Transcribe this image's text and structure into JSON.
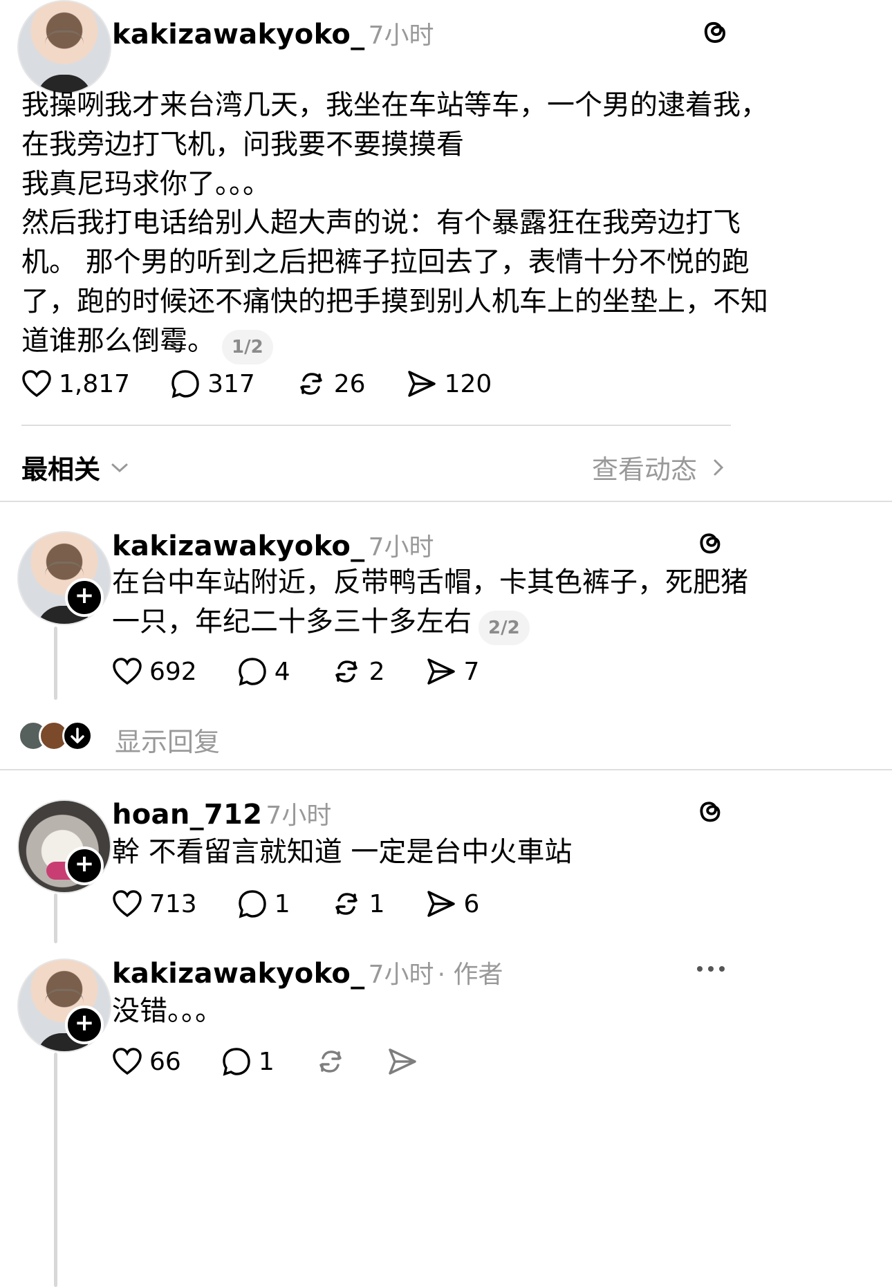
{
  "post": {
    "username": "kakizawakyoko_",
    "time": "7小时",
    "text": "我操咧我才来台湾几天，我坐在车站等车，一个男的逮着我，\n在我旁边打飞机，问我要不要摸摸看",
    "text2": "我真尼玛求你了。。。",
    "text3": "然后我打电话给别人超大声的说：有个暴露狂在我旁边打飞\n机。 那个男的听到之后把裤子拉回去了，表情十分不悦的跑\n了，跑的时候还不痛快的把手摸到别人机车上的坐垫上，不知\n道谁那么倒霉。",
    "pager": "1/2",
    "likes": "1,817",
    "comments": "317",
    "reposts": "26",
    "shares": "120"
  },
  "sort": {
    "label": "最相关",
    "activity": "查看动态"
  },
  "replies": [
    {
      "username": "kakizawakyoko_",
      "time": "7小时",
      "text": "在台中车站附近，反带鸭舌帽，卡其色裤子，死肥猪\n一只，年纪二十多三十多左右",
      "pager": "2/2",
      "likes": "692",
      "comments": "4",
      "reposts": "2",
      "shares": "7",
      "show_replies": "显示回复"
    },
    {
      "username": "hoan_712",
      "time": "7小时",
      "text": "幹 不看留言就知道 一定是台中火車站",
      "likes": "713",
      "comments": "1",
      "reposts": "1",
      "shares": "6"
    },
    {
      "username": "kakizawakyoko_",
      "time": "7小时",
      "author_tag": "· 作者",
      "text": "没错。。。",
      "likes": "66",
      "comments": "1"
    }
  ],
  "icons": {
    "threads": "threads-icon",
    "heart": "heart-icon",
    "comment": "comment-icon",
    "repost": "repost-icon",
    "share": "share-icon",
    "more": "more-icon"
  }
}
